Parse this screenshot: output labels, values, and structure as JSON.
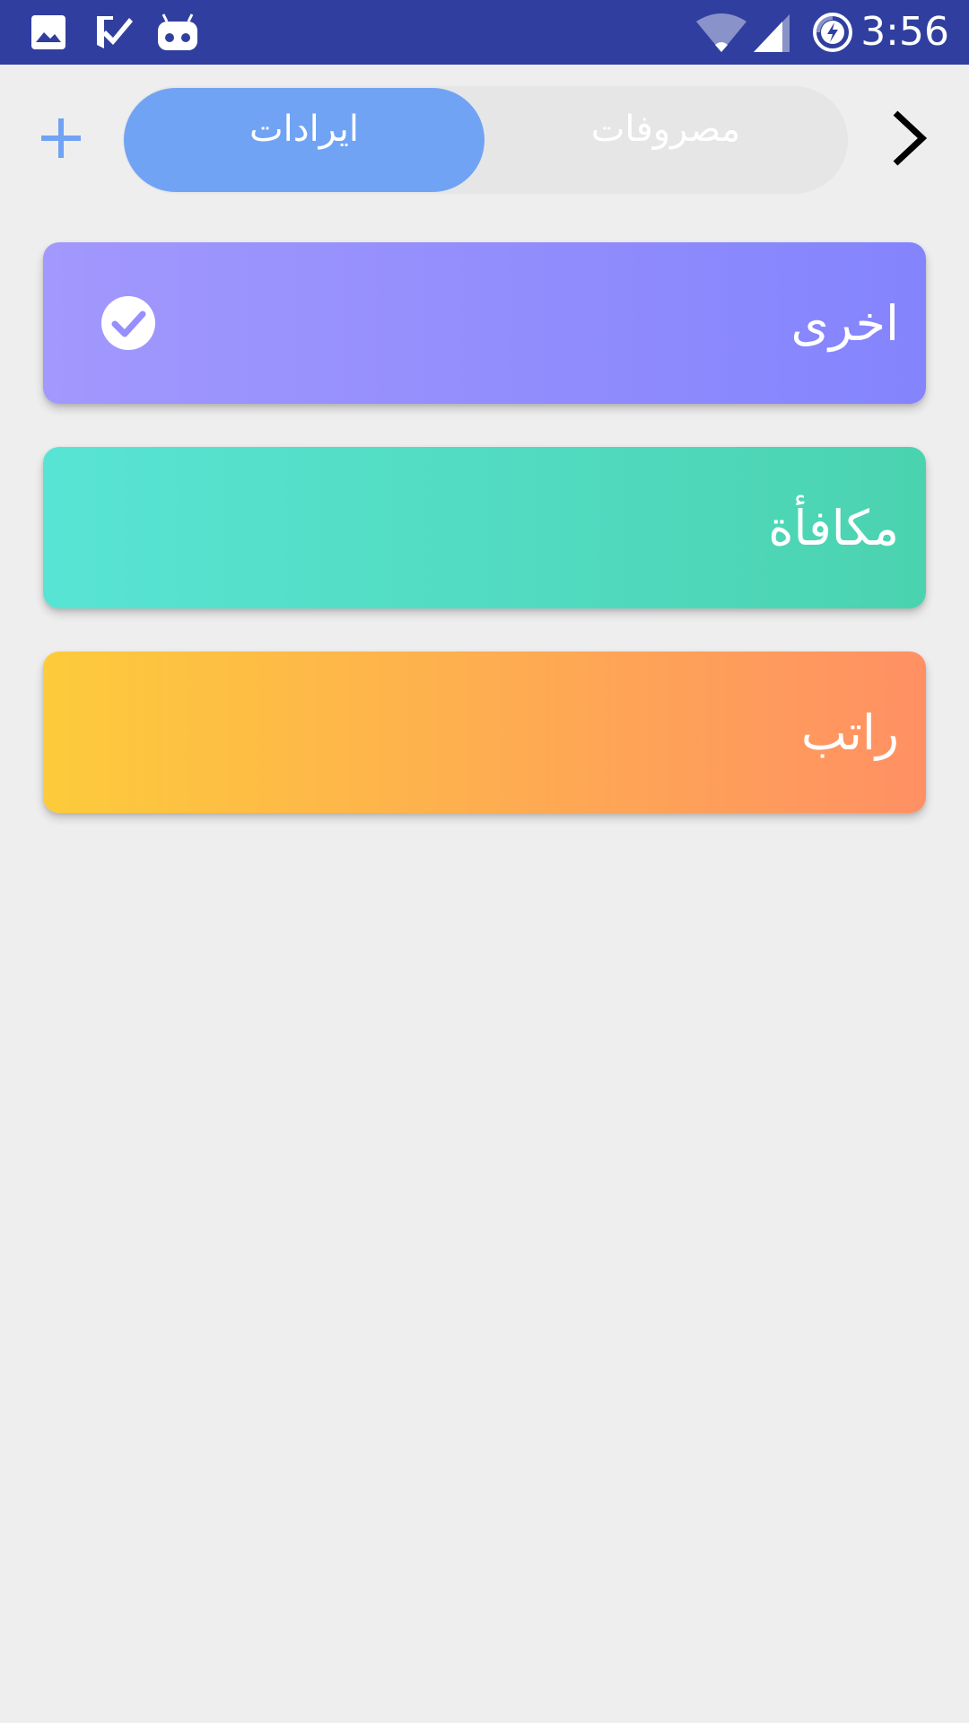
{
  "status_bar": {
    "time": "3:56",
    "left_icons": [
      "image-icon",
      "checklist-icon",
      "android-icon"
    ],
    "right_icons": [
      "wifi-icon",
      "cell-signal-icon",
      "battery-charging-icon"
    ],
    "background_color": "#303f9f"
  },
  "top_bar": {
    "add_icon": "plus-icon",
    "next_icon": "chevron-right-icon",
    "tabs": [
      {
        "label": "ایرادات",
        "active": true
      },
      {
        "label": "مصروفات",
        "active": false
      }
    ],
    "accent_color": "#70a3f4"
  },
  "categories": [
    {
      "label": "اخرى",
      "selected": true,
      "gradient": [
        "#a298fd",
        "#8484fd"
      ]
    },
    {
      "label": "مكافأة",
      "selected": false,
      "gradient": [
        "#58e4d4",
        "#4bd3b0"
      ]
    },
    {
      "label": "راتب",
      "selected": false,
      "gradient": [
        "#fdcb3b",
        "#ff9064"
      ]
    }
  ]
}
